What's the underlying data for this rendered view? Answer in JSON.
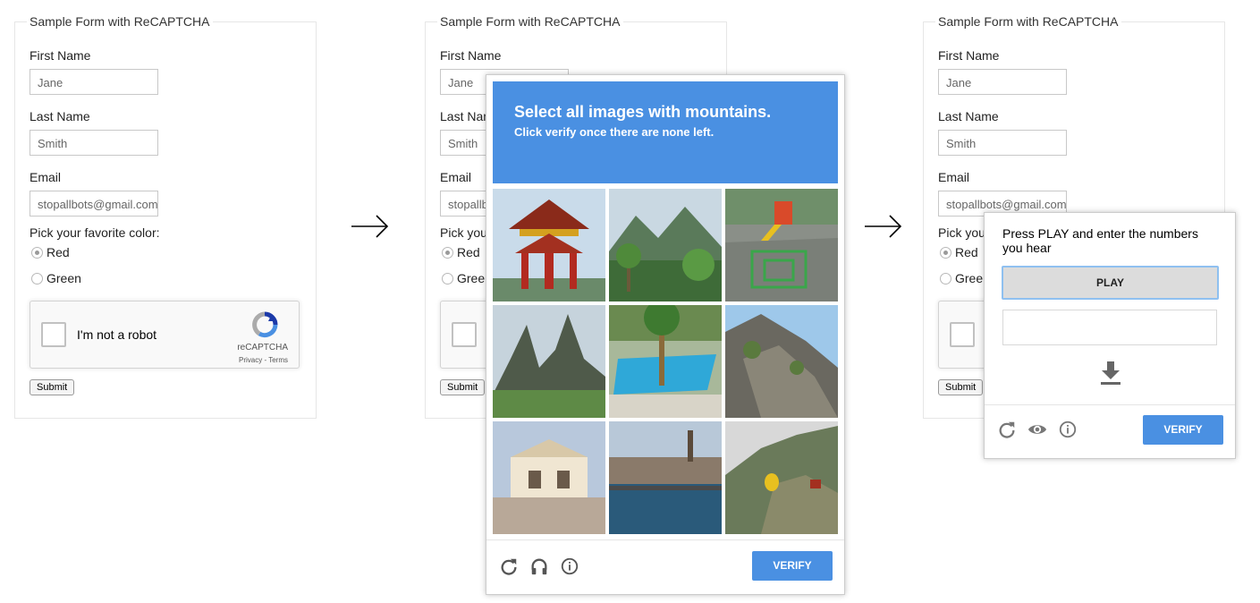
{
  "form": {
    "legend": "Sample Form with ReCAPTCHA",
    "first_name_label": "First Name",
    "first_name_value": "Jane",
    "last_name_label": "Last Name",
    "last_name_value": "Smith",
    "email_label": "Email",
    "email_value": "stopallbots@gmail.com",
    "color_prompt": "Pick your favorite color:",
    "color_prompt_short": "Pick you",
    "options": [
      "Red",
      "Green"
    ],
    "submit_label": "Submit"
  },
  "recaptcha": {
    "checkbox_label": "I'm not a robot",
    "brand": "reCAPTCHA",
    "links": "Privacy - Terms"
  },
  "image_challenge": {
    "title_prefix": "Select all images with ",
    "title_keyword": "mountains.",
    "subtitle": "Click verify once there are none left.",
    "verify_label": "VERIFY",
    "header_color": "#4a90e2",
    "tiles": [
      "pagoda",
      "mountain-forest",
      "playground",
      "twin-peaks",
      "pool-palm",
      "rocky-slope",
      "building",
      "river-city",
      "cliff-statue"
    ],
    "footer_icons": [
      "reload-icon",
      "headphones-icon",
      "info-icon"
    ]
  },
  "audio_challenge": {
    "title": "Press PLAY and enter the numbers you hear",
    "play_label": "PLAY",
    "verify_label": "VERIFY",
    "footer_icons": [
      "reload-icon",
      "eye-icon",
      "info-icon"
    ]
  }
}
